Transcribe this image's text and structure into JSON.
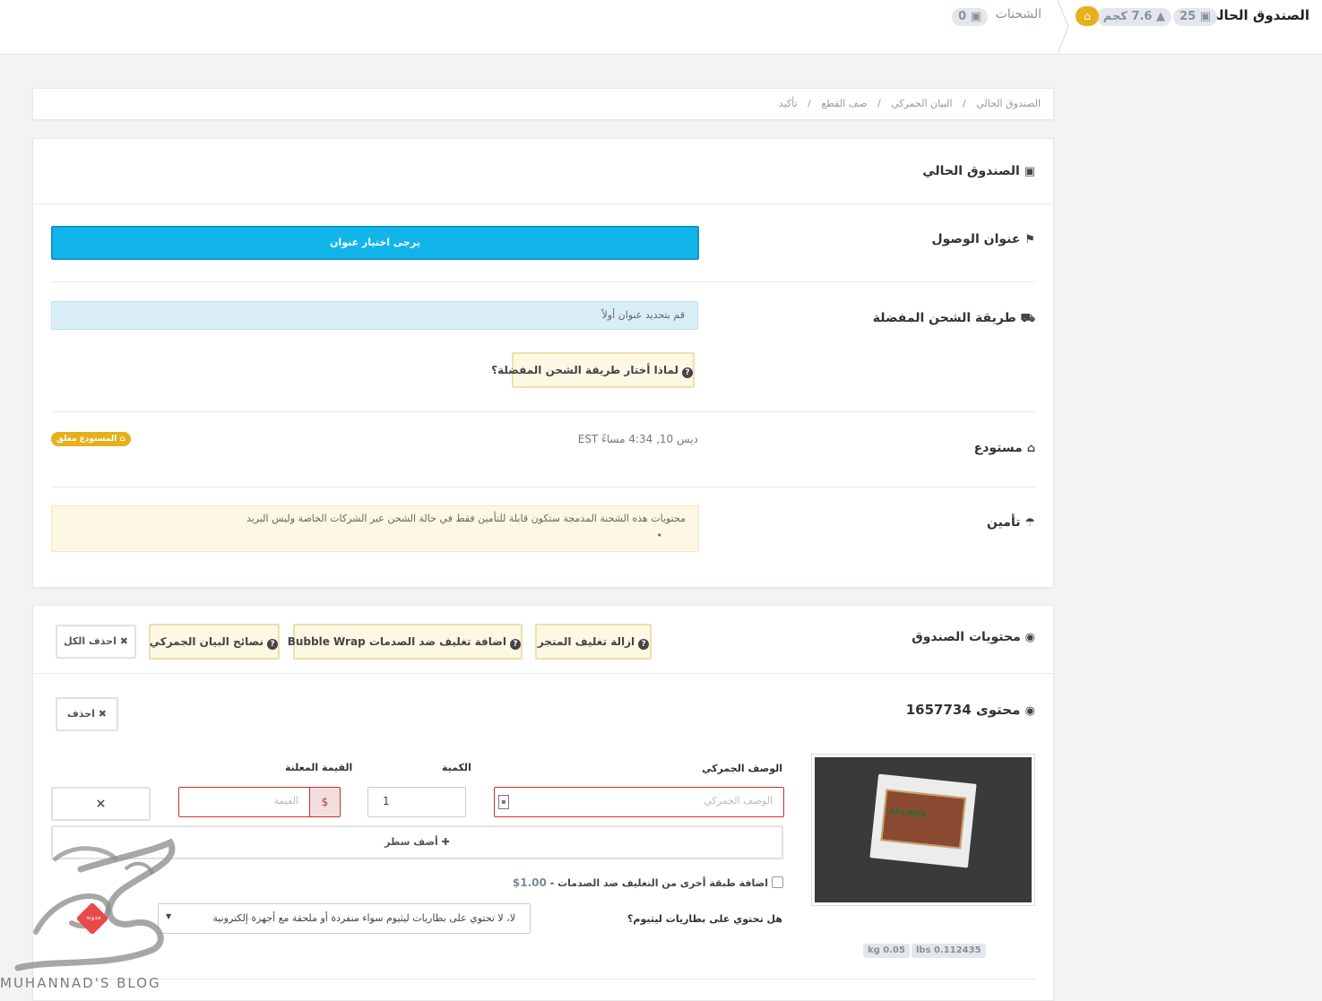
{
  "topbar": {
    "current_box_label": "الصندوق الحالي",
    "items_count": "25",
    "weight": "7.6 كجم",
    "shipments_label": "الشحنات",
    "shipments_count": "0"
  },
  "breadcrumb": {
    "items": [
      "الصندوق الحالي",
      "البيان الجمركي",
      "صف القطع",
      "تأكيد"
    ]
  },
  "current_box": {
    "title": "الصندوق الحالي",
    "arrival_address_label": "عنوان الوصول",
    "choose_address_button": "يرجى اختيار عنوان",
    "shipping_method_label": "طريقة الشحن المفضلة",
    "shipping_method_info": "قم بتحديد عنوان أولاً",
    "why_shipping_button": "لماذا أختار طريقة الشحن المفضلة؟",
    "warehouse_label": "مستودع",
    "warehouse_time": "ديس 10, 4:34 مساءً EST",
    "warehouse_badge": "المستودع مغلق",
    "insurance_label": "تأمين",
    "insurance_text": "محتويات هذه الشحنة المدمجة ستكون قابلة للتأمين فقط في حالة الشحن عبر الشركات الخاصة وليس البريد",
    "insurance_bullet": "•"
  },
  "box_contents": {
    "title": "محتويات الصندوق",
    "buttons": {
      "remove_store_packaging": "ازالة تغليف المتجر",
      "add_bubble_wrap": "اضافة تغليف ضد الصدمات Bubble Wrap",
      "customs_tips": "نصائح البيان الجمركي",
      "delete_all": "احذف الكل"
    }
  },
  "item": {
    "title": "محتوى 1657734",
    "delete_button": "احذف",
    "image_label": "AFLINTA",
    "weight_kg": "kg 0.05",
    "weight_lbs": "lbs 0.112435",
    "customs_desc_label": "الوصف الجمركي",
    "customs_desc_placeholder": "الوصف الجمركي",
    "quantity_label": "الكمية",
    "quantity_value": "1",
    "declared_value_label": "القيمة المعلنة",
    "currency_symbol": "$",
    "value_placeholder": "القيمة",
    "remove_row": "×",
    "add_row_button": "أضف سطر",
    "extra_bubble_label": "اضافة طبقة أخرى من التغليف ضد الصدمات -",
    "extra_bubble_price": "1.00$",
    "lithium_label": "هل تحتوي على بطاريات ليثيوم؟",
    "lithium_selected": "لا، لا تحتوي على بطاريات ليثيوم سواء منفردة أو ملحقة مع أجهزة إلكترونية"
  },
  "watermark": {
    "brand": "MUHANNAD'S BLOG",
    "stamp": "مدونة"
  },
  "colors": {
    "primary_button": "#12b5ea",
    "info_bg": "#d9edf7",
    "warn_bg": "#fcf8e3",
    "badge_yellow": "#e6b01d",
    "error_border": "#c9302c"
  }
}
